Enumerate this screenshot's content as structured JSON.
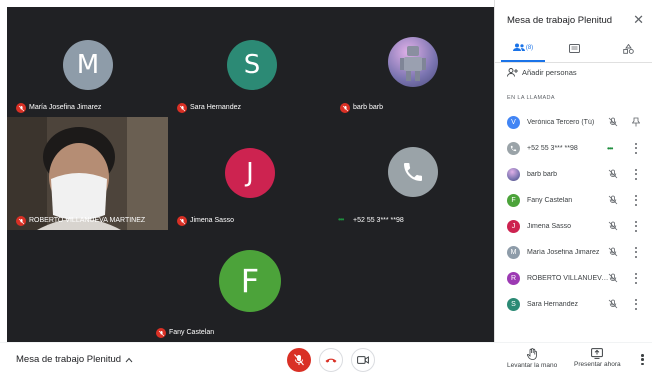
{
  "colors": {
    "tile_bg": "#202124",
    "mic_off": "#d93025",
    "accent": "#1a73e8"
  },
  "tiles": [
    {
      "name": "María Josefina Jimarez",
      "initial": "M",
      "avatar_color": "#8e9ca9"
    },
    {
      "name": "Sara Hernandez",
      "initial": "S",
      "avatar_color": "#2c8a75"
    },
    {
      "name": "barb barb",
      "initial": "",
      "avatar_color": "#7a74b0"
    },
    {
      "name": "ROBERTO VILLANUEVA MARTINEZ",
      "initial": "",
      "avatar_color": "#5b5046"
    },
    {
      "name": "Jimena Sasso",
      "initial": "J",
      "avatar_color": "#cd2350"
    },
    {
      "name": "+52 55 3*** **98",
      "initial": "",
      "avatar_color": "#9aa3a8"
    },
    {
      "name": "Fany Castelan",
      "initial": "F",
      "avatar_color": "#4ca33a"
    }
  ],
  "panel": {
    "title": "Mesa de trabajo Plenitud",
    "people_count": "(8)",
    "add_people": "Añadir personas",
    "section_label": "EN LA LLAMADA",
    "participants": [
      {
        "name": "Verónica Tercero (Tú)",
        "initial": "V",
        "color": "#4285f4"
      },
      {
        "name": "+52 55 3*** **98",
        "initial": "",
        "color": "#9aa3a8"
      },
      {
        "name": "barb barb",
        "initial": "",
        "color": "#7a74b0"
      },
      {
        "name": "Fany Castelan",
        "initial": "F",
        "color": "#4ca33a"
      },
      {
        "name": "Jimena Sasso",
        "initial": "J",
        "color": "#cd2350"
      },
      {
        "name": "María Josefina Jimarez",
        "initial": "M",
        "color": "#8e9ca9"
      },
      {
        "name": "ROBERTO VILLANUEVA ...",
        "initial": "R",
        "color": "#9c3ab3"
      },
      {
        "name": "Sara Hernandez",
        "initial": "S",
        "color": "#2c8a75"
      }
    ]
  },
  "bottom": {
    "meeting_title": "Mesa de trabajo Plenitud",
    "raise_hand": "Levantar la mano",
    "present_now": "Presentar ahora"
  }
}
